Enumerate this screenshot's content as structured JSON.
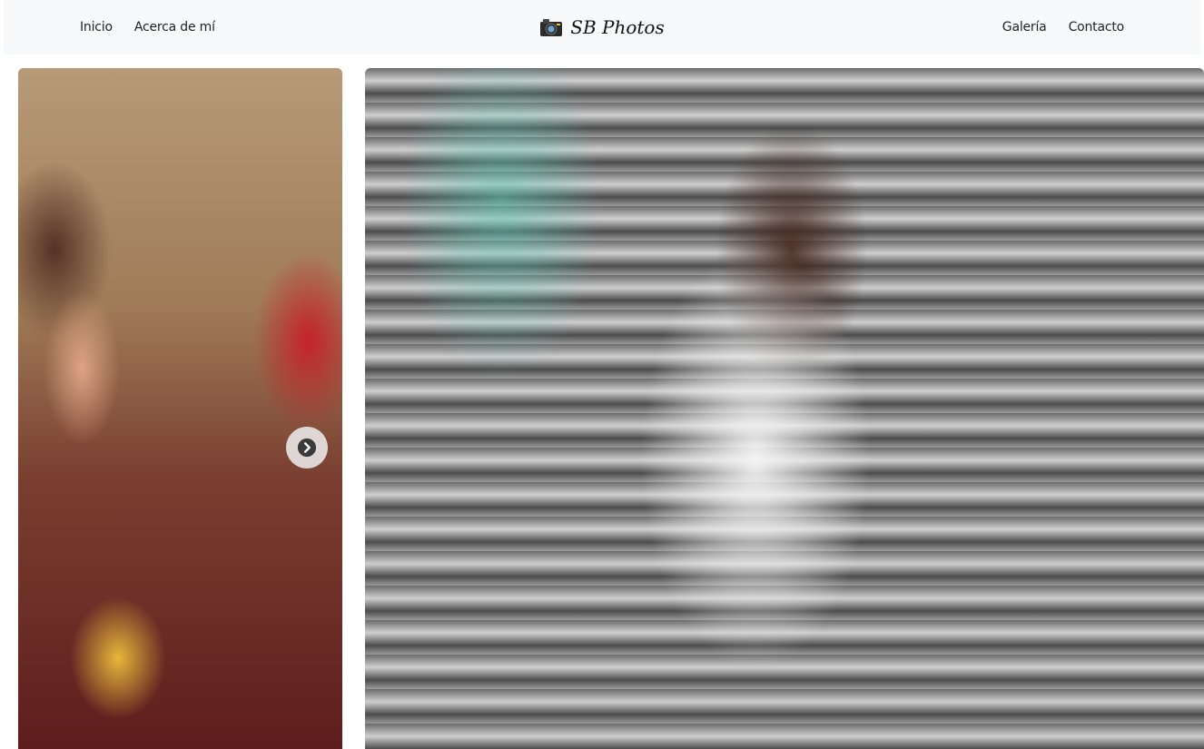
{
  "nav": {
    "left_links": [
      "Inicio",
      "Acerca de mí"
    ],
    "right_links": [
      "Galería",
      "Contacto"
    ],
    "brand": {
      "icon": "camera-icon",
      "text": "SB Photos"
    }
  },
  "gallery": {
    "carousel_button_icon": "chevron-right-icon",
    "photos": [
      {
        "name": "quinceanera-cake-photo"
      },
      {
        "name": "graffiti-portrait-photo"
      }
    ]
  },
  "colors": {
    "navbar_bg": "#f8f9fa",
    "text": "#222222"
  }
}
